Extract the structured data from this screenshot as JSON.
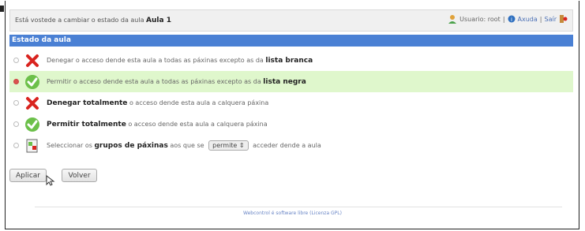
{
  "topbar": {
    "message_prefix": "Está vostede a cambiar o estado da aula",
    "classroom": "Aula 1",
    "user_label": "Usuario: root",
    "separator": "|",
    "help_link": "Axuda",
    "logout_link": "Saír"
  },
  "section": {
    "title": "Estado da aula"
  },
  "options": [
    {
      "icon": "red-x-icon",
      "selected": false,
      "text_before": "Denegar o acceso dende esta aula a todas as páxinas excepto as da",
      "bold": "lista branca",
      "text_after": ""
    },
    {
      "icon": "green-check-icon",
      "selected": true,
      "text_before": "Permitir o acceso dende esta aula a todas as páxinas excepto as da",
      "bold": "lista negra",
      "text_after": ""
    },
    {
      "icon": "red-x-icon",
      "selected": false,
      "text_before": "",
      "bold": "Denegar totalmente",
      "text_after": "o acceso dende esta aula a calquera páxina"
    },
    {
      "icon": "green-check-icon",
      "selected": false,
      "text_before": "",
      "bold": "Permitir totalmente",
      "text_after": "o acceso dende esta aula a calquera páxina"
    },
    {
      "icon": "page-groups-icon",
      "selected": false,
      "text_before": "Seleccionar os",
      "bold": "grupos de páxinas",
      "text_mid": "aos que se",
      "select_value": "permite",
      "text_after": "acceder dende a aula"
    }
  ],
  "buttons": {
    "apply": "Aplicar",
    "back": "Volver"
  },
  "footer": "Webcontrol é software libre (Licenza GPL)"
}
